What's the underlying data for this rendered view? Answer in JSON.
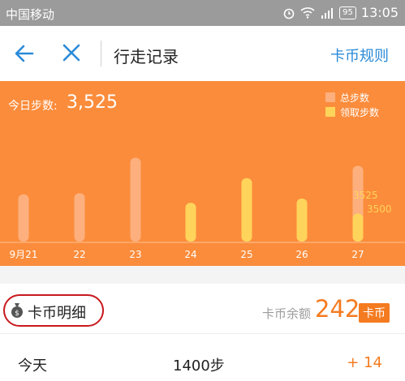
{
  "status_bar": {
    "carrier": "中国移动",
    "battery": "95",
    "time": "13:05"
  },
  "nav": {
    "title": "行走记录",
    "rules_label": "卡币规则"
  },
  "chart_data": {
    "type": "bar",
    "categories": [
      "9月21",
      "22",
      "23",
      "24",
      "25",
      "26",
      "27"
    ],
    "series": [
      {
        "name": "总步数",
        "values": [
          2200,
          2250,
          3900,
          1800,
          2950,
          2000,
          3525
        ]
      },
      {
        "name": "领取步数",
        "values": [
          0,
          0,
          0,
          1800,
          2950,
          2000,
          1300
        ]
      }
    ],
    "today_label": "今日步数:",
    "today_value": "3,525",
    "value_labels": {
      "total": "3525",
      "claimed": "3500"
    },
    "colors": {
      "background": "#fb8c3b",
      "total": "#fdb07e",
      "claimed": "#ffd45a"
    }
  },
  "detail": {
    "header_label": "卡币明细",
    "balance_label": "卡币余额",
    "balance_value": "242",
    "balance_unit": "卡币",
    "rows": [
      {
        "day": "今天",
        "steps": "1400步",
        "coins": "+ 14"
      }
    ]
  }
}
